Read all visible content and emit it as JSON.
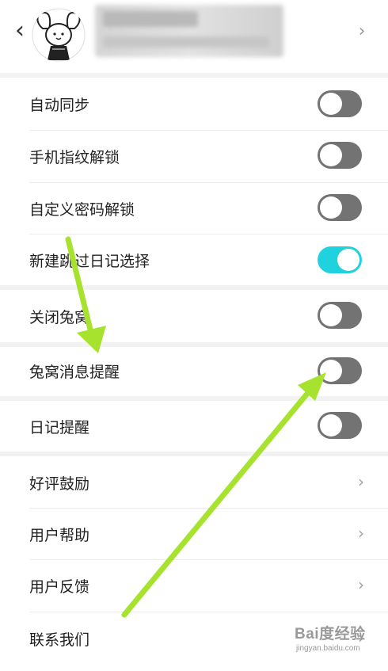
{
  "header": {
    "back_glyph": "‹",
    "chevron_glyph": "›"
  },
  "settings": {
    "items": [
      {
        "label": "自动同步",
        "type": "toggle",
        "on": false
      },
      {
        "label": "手机指纹解锁",
        "type": "toggle",
        "on": false
      },
      {
        "label": "自定义密码解锁",
        "type": "toggle",
        "on": false
      },
      {
        "label": "新建跳过日记选择",
        "type": "toggle",
        "on": true
      },
      {
        "label": "关闭兔窝",
        "type": "toggle",
        "on": false
      },
      {
        "label": "兔窝消息提醒",
        "type": "toggle",
        "on": false
      },
      {
        "label": "日记提醒",
        "type": "toggle",
        "on": false
      },
      {
        "label": "好评鼓励",
        "type": "link"
      },
      {
        "label": "用户帮助",
        "type": "link"
      },
      {
        "label": "用户反馈",
        "type": "link"
      },
      {
        "label": "联系我们",
        "type": "link"
      }
    ],
    "chevron_glyph": "›"
  },
  "colors": {
    "toggle_on": "#20d2dd",
    "toggle_off": "#737373",
    "annotation_arrow": "#a6e22e"
  },
  "icons": [
    "back-arrow-icon",
    "bunny-avatar-icon",
    "chevron-right-icon"
  ],
  "watermark": {
    "brand": "Bai度经验",
    "url": "jingyan.baidu.com"
  }
}
